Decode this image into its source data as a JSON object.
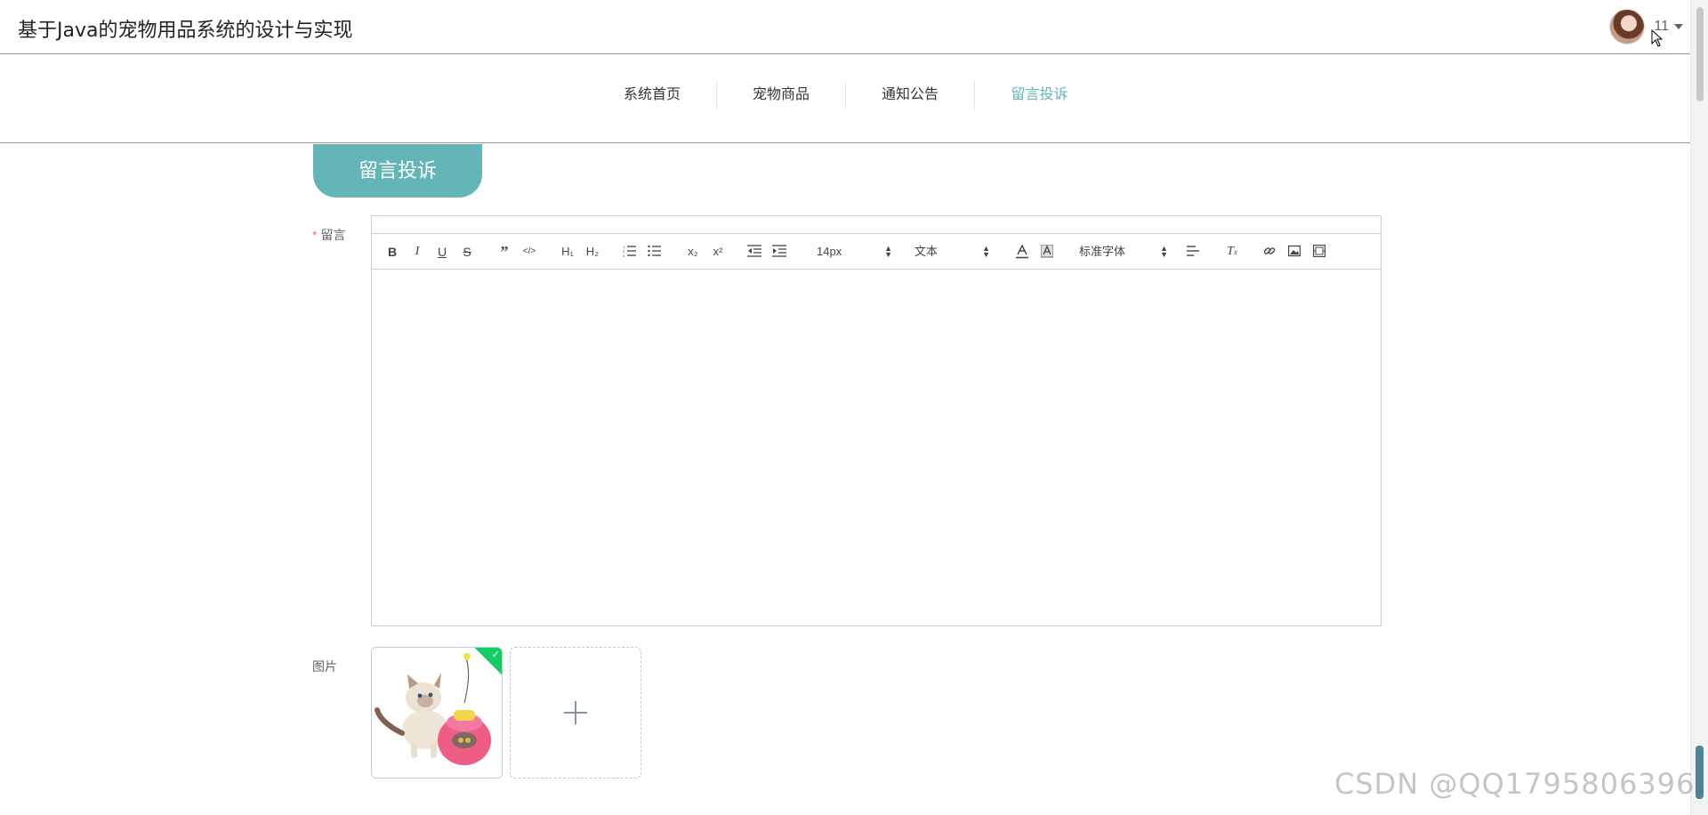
{
  "header": {
    "site_title": "基于Java的宠物用品系统的设计与实现",
    "user_name": "11",
    "avatar_icon": "user-avatar",
    "dropdown_icon": "caret-down-icon"
  },
  "nav": {
    "items": [
      {
        "label": "系统首页"
      },
      {
        "label": "宠物商品"
      },
      {
        "label": "通知公告"
      },
      {
        "label": "留言投诉",
        "active": true
      }
    ],
    "active_color": "#64b5b7"
  },
  "section": {
    "title": "留言投诉",
    "color": "#64b5b7"
  },
  "form": {
    "message": {
      "required_mark": "*",
      "label": "留言",
      "value": ""
    },
    "toolbar": {
      "buttons": [
        "bold-icon",
        "italic-icon",
        "underline-icon",
        "strikethrough-icon",
        "blockquote-icon",
        "code-icon",
        "h1-icon",
        "h2-icon",
        "ordered-list-icon",
        "bullet-list-icon",
        "subscript-icon",
        "superscript-icon",
        "outdent-icon",
        "indent-icon",
        "font-color-icon",
        "background-color-icon",
        "align-icon",
        "clear-format-icon",
        "link-icon",
        "image-icon",
        "video-icon"
      ],
      "font_size": "14px",
      "header_select": "文本",
      "font_family": "标准字体"
    },
    "image": {
      "label": "图片",
      "uploaded_icon": "cat-toy-photo",
      "success_icon": "check-icon",
      "add_icon": "plus-icon"
    }
  },
  "watermark": "CSDN @QQ1795806396"
}
